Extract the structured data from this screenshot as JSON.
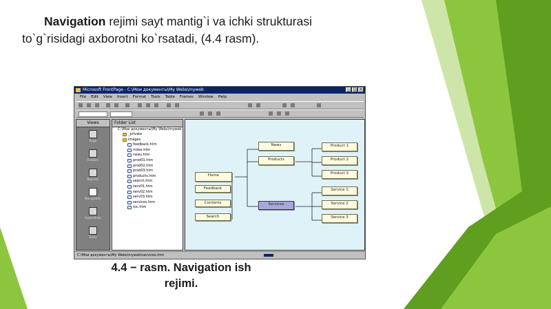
{
  "slide": {
    "text_bold": "Navigation",
    "text_line1_rest": " rejimi sayt mantig`i va ichki strukturasi",
    "text_line2": "to`g`risidagi axborotni ko`rsatadi, (4.4 rasm).",
    "caption_line1": "4.4 − rasm. Navigation ish",
    "caption_line2": "rejimi."
  },
  "colors": {
    "green_dark": "#5f9e1f",
    "green_mid": "#8cc63f",
    "green_light": "#cde5a8",
    "title_bar": "#0a246a",
    "nav_bg": "#dff2f8"
  },
  "app": {
    "title": "Microsoft FrontPage - C:\\Mои документы\\My Webs\\myweb",
    "menu": [
      "File",
      "Edit",
      "View",
      "Insert",
      "Format",
      "Tools",
      "Table",
      "Frames",
      "Window",
      "Help"
    ],
    "views_header": "Views",
    "views": [
      "Page",
      "Folders",
      "Reports",
      "Navigation",
      "Hyperlinks",
      "Tasks"
    ],
    "folder_header": "Folder List",
    "folder_root": "C:\\Mои документы\\My Webs\\myweb",
    "folders": [
      "_private",
      "images"
    ],
    "files": [
      "feedback.htm",
      "index.htm",
      "news.htm",
      "prod01.htm",
      "prod02.htm",
      "prod03.htm",
      "products.htm",
      "search.htm",
      "serv01.htm",
      "serv02.htm",
      "serv03.htm",
      "services.htm",
      "toc.htm"
    ],
    "nav_nodes": {
      "home": "Home",
      "feedback": "Feedback",
      "contents": "Contents",
      "search": "Search",
      "news": "News",
      "products": "Products",
      "services": "Services",
      "product1": "Product 1",
      "product2": "Product 2",
      "product3": "Product 3",
      "service1": "Service 1",
      "service2": "Service 2",
      "service3": "Service 3"
    },
    "status": "C:\\Mои документы\\My Webs\\myweb\\services.htm"
  }
}
